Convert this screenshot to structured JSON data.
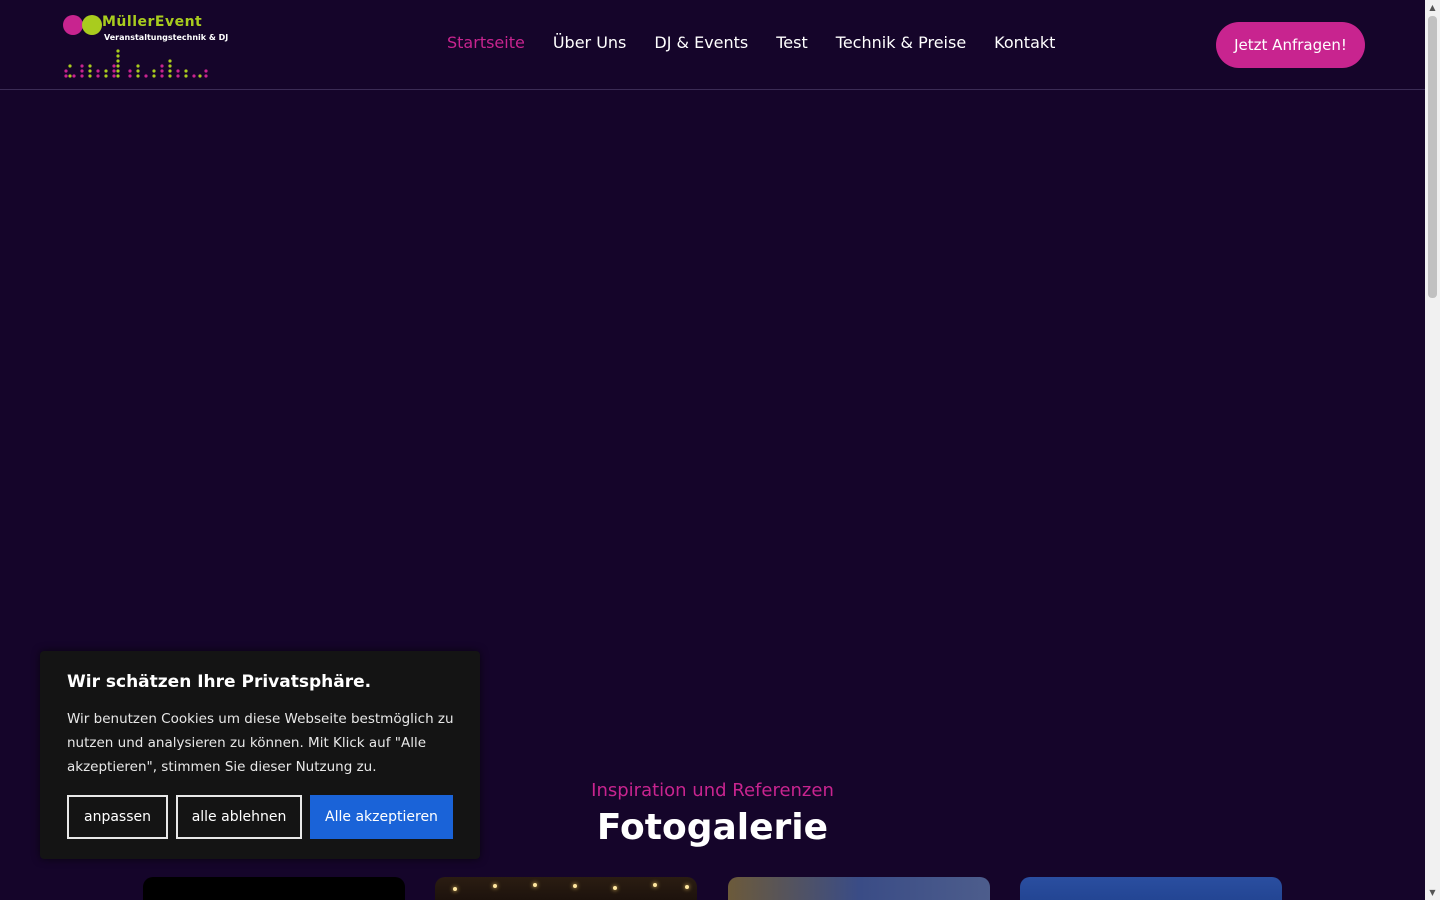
{
  "brand": {
    "name_line1": "MüllerEvent",
    "name_line2": "Veranstaltungstechnik & DJ"
  },
  "nav": {
    "items": [
      {
        "label": "Startseite",
        "active": true
      },
      {
        "label": "Über Uns",
        "active": false
      },
      {
        "label": "DJ & Events",
        "active": false
      },
      {
        "label": "Test",
        "active": false
      },
      {
        "label": "Technik & Preise",
        "active": false
      },
      {
        "label": "Kontakt",
        "active": false
      }
    ],
    "cta_label": "Jetzt Anfragen!"
  },
  "gallery": {
    "subtitle": "Inspiration und Referenzen",
    "title": "Fotogalerie"
  },
  "cookie_banner": {
    "title": "Wir schätzen Ihre Privatsphäre.",
    "text": "Wir benutzen Cookies um diese Webseite bestmöglich zu nutzen und analysieren zu können. Mit Klick auf \"Alle akzeptieren\", stimmen Sie dieser Nutzung zu.",
    "customize_label": "anpassen",
    "reject_label": "alle ablehnen",
    "accept_label": "Alle akzeptieren"
  },
  "colors": {
    "background": "#15052a",
    "accent": "#c8248f",
    "logo_green": "#a9cc1e",
    "accept_blue": "#1a63d8"
  }
}
